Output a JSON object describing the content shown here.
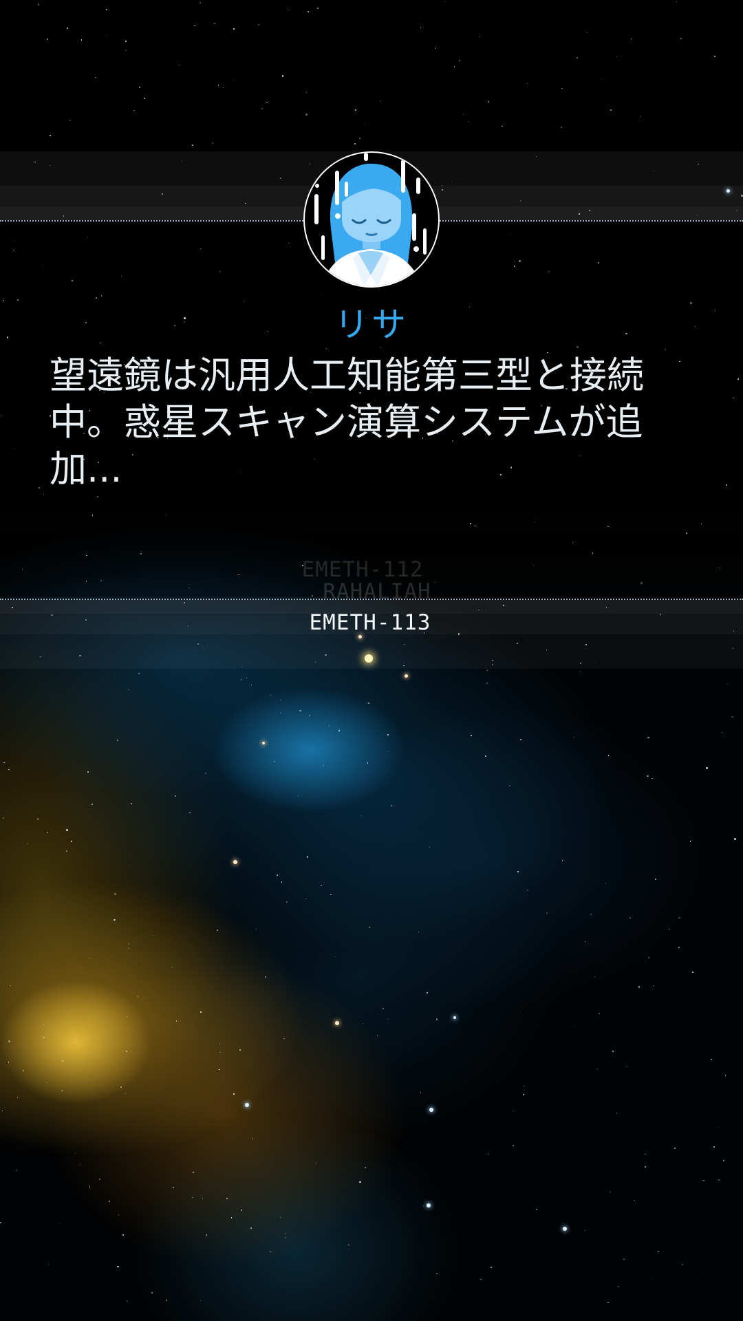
{
  "speaker": {
    "name": "リサ",
    "avatar_icon": "woman-portrait-icon"
  },
  "dialogue": {
    "text": "望遠鏡は汎用人工知能第三型と接続中。惑星スキャン演算システムが追加..."
  },
  "targets": {
    "previous": "EMETH-112",
    "previous_2": "RAHALIAH",
    "current": "EMETH-113"
  },
  "colors": {
    "accent": "#35a8ee",
    "text": "#e8eef2",
    "background": "#010203"
  }
}
